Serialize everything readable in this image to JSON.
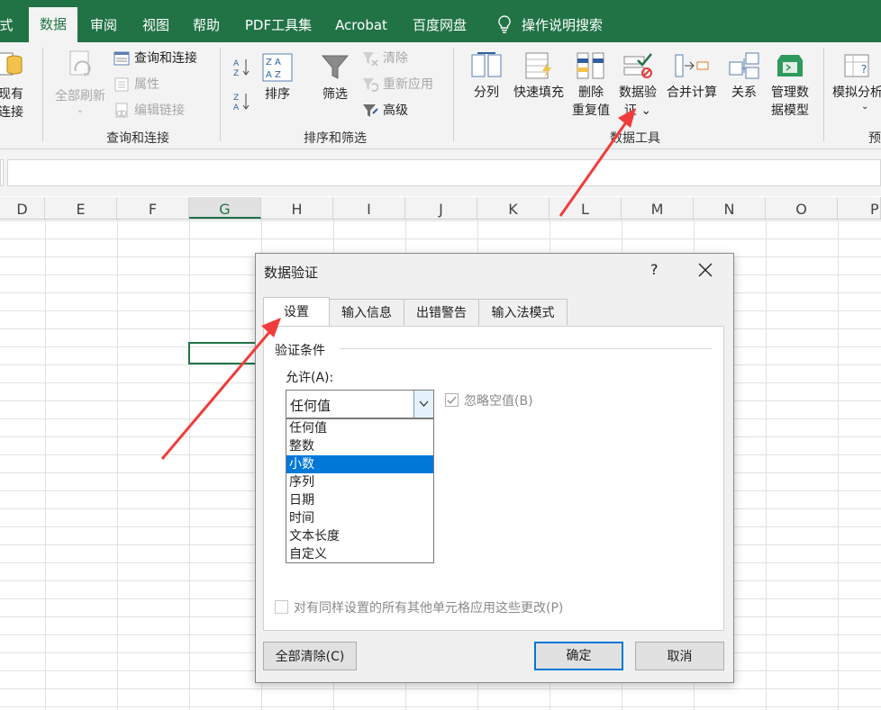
{
  "menu": {
    "tabs": [
      "式",
      "数据",
      "审阅",
      "视图",
      "帮助",
      "PDF工具集",
      "Acrobat",
      "百度网盘",
      "操作说明搜索"
    ],
    "active": "数据"
  },
  "ribbon": {
    "existing_conn": "现有\n连接",
    "refresh_all": "全部刷新",
    "query_conn": "查询和连接",
    "properties": "属性",
    "edit_links": "编辑链接",
    "group_query": "查询和连接",
    "sort": "排序",
    "filter": "筛选",
    "clear": "清除",
    "reapply": "重新应用",
    "advanced": "高级",
    "group_sort": "排序和筛选",
    "text_to_columns": "分列",
    "flash_fill": "快速填充",
    "remove_dup": "删除\n重复值",
    "data_validation": "数据验\n证 ⌄",
    "consolidate": "合并计算",
    "relationships": "关系",
    "manage_model": "管理数\n据模型",
    "group_data_tools": "数据工具",
    "what_if": "模拟分析",
    "group_forecast": "预"
  },
  "columns": [
    "D",
    "E",
    "F",
    "G",
    "H",
    "I",
    "J",
    "K",
    "L",
    "M",
    "N",
    "O",
    "P"
  ],
  "selected_column": "G",
  "dialog": {
    "title": "数据验证",
    "help": "?",
    "tabs": [
      "设置",
      "输入信息",
      "出错警告",
      "输入法模式"
    ],
    "active_tab": "设置",
    "section": "验证条件",
    "allow_label": "允许(A):",
    "allow_value": "任何值",
    "ignore_blank": "忽略空值(B)",
    "options": [
      "任何值",
      "整数",
      "小数",
      "序列",
      "日期",
      "时间",
      "文本长度",
      "自定义"
    ],
    "highlighted_option": "小数",
    "apply_all": "对有同样设置的所有其他单元格应用这些更改(P)",
    "clear_all": "全部清除(C)",
    "ok": "确定",
    "cancel": "取消"
  },
  "colors": {
    "excel_green": "#217346",
    "arrow_red": "#f03c3c",
    "select_blue": "#0078d7"
  }
}
